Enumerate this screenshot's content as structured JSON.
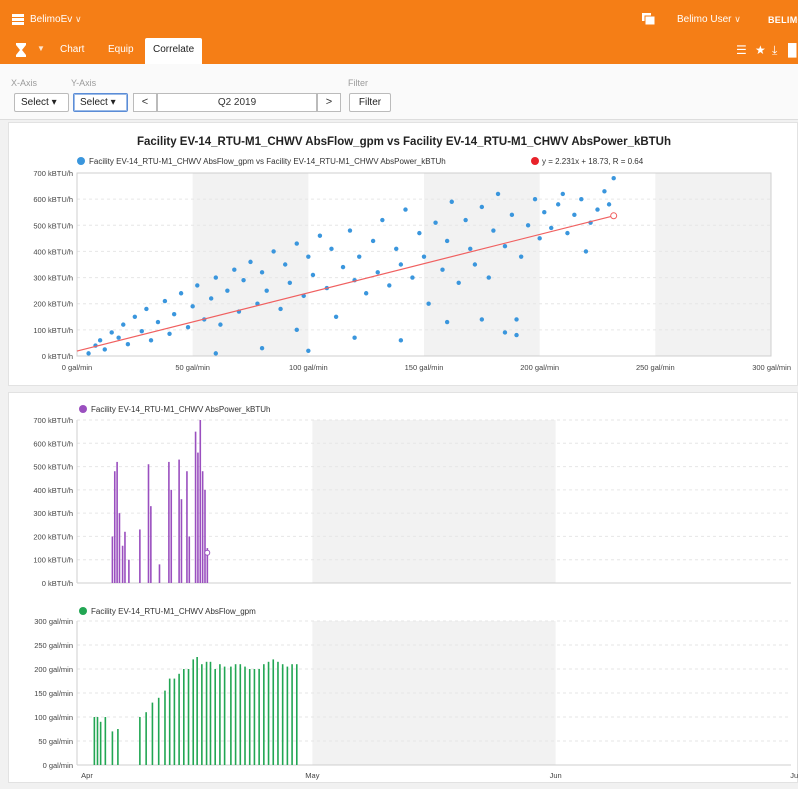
{
  "app": {
    "title": "BelimoEv",
    "caret": "∨",
    "user": "Belimo User",
    "logo": "BELIMO"
  },
  "tabs": [
    {
      "label": "Chart"
    },
    {
      "label": "Equip"
    },
    {
      "label": "Correlate"
    }
  ],
  "toolbar": {
    "xaxis_label": "X-Axis",
    "yaxis_label": "Y-Axis",
    "filter_label": "Filter",
    "x_select": "Select ▾",
    "y_select": "Select ▾",
    "prev": "<",
    "next": ">",
    "period": "Q2 2019",
    "filter_button": "Filter"
  },
  "colors": {
    "accent": "#f57e16",
    "scatter": "#3a96dd",
    "power": "#9a4fbf",
    "flow": "#22a653",
    "trend": "#f06060"
  },
  "chart_data": [
    {
      "type": "scatter",
      "title": "Facility EV-14_RTU-M1_CHWV AbsFlow_gpm vs Facility EV-14_RTU-M1_CHWV AbsPower_kBTUh",
      "legend": [
        "Facility EV-14_RTU-M1_CHWV AbsFlow_gpm vs Facility EV-14_RTU-M1_CHWV AbsPower_kBTUh",
        "y = 2.231x + 18.73, R = 0.64"
      ],
      "x_ticks": [
        "0 gal/min",
        "50 gal/min",
        "100 gal/min",
        "150 gal/min",
        "200 gal/min",
        "250 gal/min",
        "300 gal/min"
      ],
      "y_ticks": [
        "0 kBTU/h",
        "100 kBTU/h",
        "200 kBTU/h",
        "300 kBTU/h",
        "400 kBTU/h",
        "500 kBTU/h",
        "600 kBTU/h",
        "700 kBTU/h"
      ],
      "xlim": [
        0,
        300
      ],
      "ylim": [
        0,
        700
      ],
      "trend": {
        "slope": 2.231,
        "intercept": 18.73,
        "x_range": [
          0,
          232
        ]
      },
      "points": [
        [
          5,
          10
        ],
        [
          8,
          40
        ],
        [
          10,
          60
        ],
        [
          12,
          25
        ],
        [
          15,
          90
        ],
        [
          18,
          70
        ],
        [
          20,
          120
        ],
        [
          22,
          45
        ],
        [
          25,
          150
        ],
        [
          28,
          95
        ],
        [
          30,
          180
        ],
        [
          32,
          60
        ],
        [
          35,
          130
        ],
        [
          38,
          210
        ],
        [
          40,
          85
        ],
        [
          42,
          160
        ],
        [
          45,
          240
        ],
        [
          48,
          110
        ],
        [
          50,
          190
        ],
        [
          52,
          270
        ],
        [
          55,
          140
        ],
        [
          58,
          220
        ],
        [
          60,
          300
        ],
        [
          62,
          120
        ],
        [
          65,
          250
        ],
        [
          68,
          330
        ],
        [
          70,
          170
        ],
        [
          72,
          290
        ],
        [
          75,
          360
        ],
        [
          78,
          200
        ],
        [
          80,
          320
        ],
        [
          82,
          250
        ],
        [
          85,
          400
        ],
        [
          88,
          180
        ],
        [
          90,
          350
        ],
        [
          92,
          280
        ],
        [
          95,
          430
        ],
        [
          98,
          230
        ],
        [
          100,
          380
        ],
        [
          102,
          310
        ],
        [
          105,
          460
        ],
        [
          108,
          260
        ],
        [
          110,
          410
        ],
        [
          112,
          150
        ],
        [
          115,
          340
        ],
        [
          118,
          480
        ],
        [
          120,
          290
        ],
        [
          122,
          380
        ],
        [
          125,
          240
        ],
        [
          128,
          440
        ],
        [
          130,
          320
        ],
        [
          132,
          520
        ],
        [
          135,
          270
        ],
        [
          138,
          410
        ],
        [
          140,
          350
        ],
        [
          142,
          560
        ],
        [
          145,
          300
        ],
        [
          148,
          470
        ],
        [
          150,
          380
        ],
        [
          152,
          200
        ],
        [
          155,
          510
        ],
        [
          158,
          330
        ],
        [
          160,
          440
        ],
        [
          162,
          590
        ],
        [
          165,
          280
        ],
        [
          168,
          520
        ],
        [
          170,
          410
        ],
        [
          172,
          350
        ],
        [
          175,
          570
        ],
        [
          178,
          300
        ],
        [
          180,
          480
        ],
        [
          182,
          620
        ],
        [
          185,
          420
        ],
        [
          188,
          540
        ],
        [
          190,
          140
        ],
        [
          192,
          380
        ],
        [
          195,
          500
        ],
        [
          198,
          600
        ],
        [
          200,
          450
        ],
        [
          202,
          550
        ],
        [
          205,
          490
        ],
        [
          208,
          580
        ],
        [
          210,
          620
        ],
        [
          212,
          470
        ],
        [
          215,
          540
        ],
        [
          218,
          600
        ],
        [
          220,
          400
        ],
        [
          222,
          510
        ],
        [
          225,
          560
        ],
        [
          228,
          630
        ],
        [
          230,
          580
        ],
        [
          232,
          680
        ],
        [
          185,
          90
        ],
        [
          190,
          80
        ],
        [
          160,
          130
        ],
        [
          175,
          140
        ],
        [
          120,
          70
        ],
        [
          100,
          20
        ],
        [
          80,
          30
        ],
        [
          60,
          10
        ],
        [
          140,
          60
        ],
        [
          95,
          100
        ]
      ]
    },
    {
      "type": "bar",
      "legend": "Facility EV-14_RTU-M1_CHWV AbsPower_kBTUh",
      "y_ticks": [
        "0 kBTU/h",
        "100 kBTU/h",
        "200 kBTU/h",
        "300 kBTU/h",
        "400 kBTU/h",
        "500 kBTU/h",
        "600 kBTU/h",
        "700 kBTU/h"
      ],
      "ylim": [
        0,
        700
      ],
      "xlim": [
        0,
        91
      ],
      "values": [
        [
          4.5,
          200
        ],
        [
          4.8,
          480
        ],
        [
          5.1,
          520
        ],
        [
          5.4,
          300
        ],
        [
          5.8,
          160
        ],
        [
          6.1,
          220
        ],
        [
          6.6,
          100
        ],
        [
          8.0,
          230
        ],
        [
          9.1,
          510
        ],
        [
          9.4,
          330
        ],
        [
          10.5,
          80
        ],
        [
          11.7,
          520
        ],
        [
          12.0,
          400
        ],
        [
          13.0,
          530
        ],
        [
          13.3,
          360
        ],
        [
          14.0,
          480
        ],
        [
          14.3,
          200
        ],
        [
          15.1,
          650
        ],
        [
          15.4,
          560
        ],
        [
          15.7,
          700
        ],
        [
          16.0,
          480
        ],
        [
          16.3,
          400
        ],
        [
          16.6,
          150
        ]
      ]
    },
    {
      "type": "bar",
      "legend": "Facility EV-14_RTU-M1_CHWV AbsFlow_gpm",
      "x_ticks": [
        "Apr",
        "May",
        "Jun",
        "Jul"
      ],
      "y_ticks": [
        "0 gal/min",
        "50 gal/min",
        "100 gal/min",
        "150 gal/min",
        "200 gal/min",
        "250 gal/min",
        "300 gal/min"
      ],
      "ylim": [
        0,
        300
      ],
      "xlim": [
        0,
        91
      ],
      "values": [
        [
          2.2,
          100
        ],
        [
          2.6,
          100
        ],
        [
          3.0,
          90
        ],
        [
          3.6,
          100
        ],
        [
          4.5,
          70
        ],
        [
          5.2,
          75
        ],
        [
          8.0,
          100
        ],
        [
          8.8,
          110
        ],
        [
          9.6,
          130
        ],
        [
          10.4,
          140
        ],
        [
          11.2,
          155
        ],
        [
          11.8,
          180
        ],
        [
          12.4,
          180
        ],
        [
          13.0,
          190
        ],
        [
          13.6,
          200
        ],
        [
          14.2,
          200
        ],
        [
          14.8,
          220
        ],
        [
          15.3,
          225
        ],
        [
          15.9,
          210
        ],
        [
          16.5,
          215
        ],
        [
          17.0,
          215
        ],
        [
          17.6,
          200
        ],
        [
          18.2,
          210
        ],
        [
          18.8,
          205
        ],
        [
          19.6,
          205
        ],
        [
          20.2,
          210
        ],
        [
          20.8,
          210
        ],
        [
          21.4,
          205
        ],
        [
          22.0,
          200
        ],
        [
          22.6,
          200
        ],
        [
          23.2,
          200
        ],
        [
          23.8,
          210
        ],
        [
          24.4,
          215
        ],
        [
          25.0,
          220
        ],
        [
          25.6,
          215
        ],
        [
          26.2,
          210
        ],
        [
          26.8,
          205
        ],
        [
          27.4,
          210
        ],
        [
          28.0,
          210
        ]
      ]
    }
  ]
}
